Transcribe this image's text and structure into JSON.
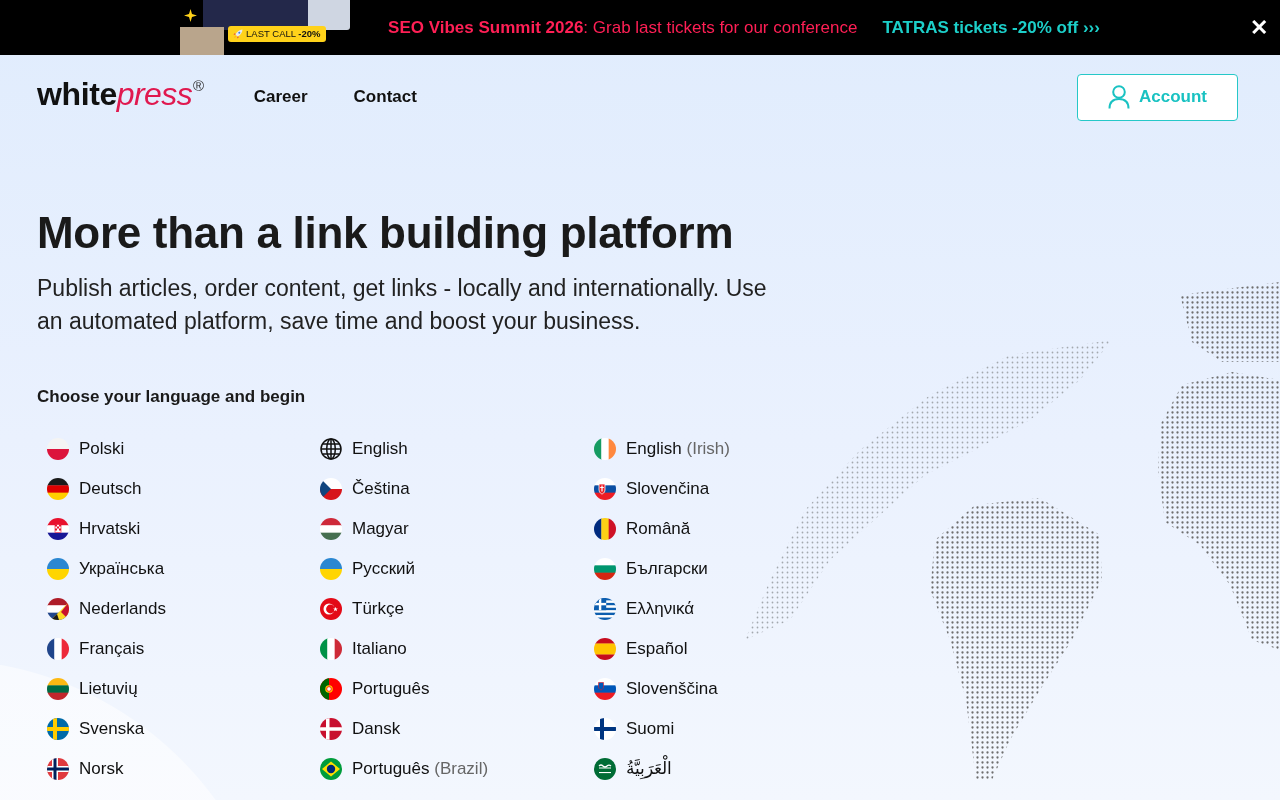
{
  "promo_banner": {
    "badge": "LAST CALL **-20%**",
    "headline": "**SEO Vibes Summit 2026**: Grab last tickets for our conference",
    "link": "TATRAS tickets -20% off ›››",
    "close": "✕"
  },
  "header": {
    "logo": {
      "word": "white",
      "accent": "press",
      "mark": "®"
    },
    "nav": [
      {
        "label": "Career"
      },
      {
        "label": "Contact"
      }
    ],
    "account_button": "Account"
  },
  "hero": {
    "title": "More than a link building platform",
    "subtitle": "Publish articles, order content, get links - locally and internationally. Use an automated platform, save time and boost your business."
  },
  "languages": {
    "heading": "Choose your language and begin",
    "items": [
      {
        "name": "Polski",
        "kind": "poland"
      },
      {
        "name": "English",
        "kind": "globe"
      },
      {
        "name": "English",
        "note": "(Irish)",
        "kind": "ireland"
      },
      {
        "name": "Deutsch",
        "kind": "germany"
      },
      {
        "name": "Čeština",
        "kind": "czechia"
      },
      {
        "name": "Slovenčina",
        "kind": "slovakia"
      },
      {
        "name": "Hrvatski",
        "kind": "croatia"
      },
      {
        "name": "Magyar",
        "kind": "hungary"
      },
      {
        "name": "Română",
        "kind": "romania"
      },
      {
        "name": "Українська",
        "kind": "ukraine"
      },
      {
        "name": "Русский",
        "kind": "ukraine"
      },
      {
        "name": "Български",
        "kind": "bulgaria"
      },
      {
        "name": "Nederlands",
        "kind": "benelux"
      },
      {
        "name": "Türkçe",
        "kind": "turkey"
      },
      {
        "name": "Ελληνικά",
        "kind": "greece"
      },
      {
        "name": "Français",
        "kind": "france"
      },
      {
        "name": "Italiano",
        "kind": "italy"
      },
      {
        "name": "Español",
        "kind": "spain"
      },
      {
        "name": "Lietuvių",
        "kind": "lithuania"
      },
      {
        "name": "Português",
        "kind": "portugal"
      },
      {
        "name": "Slovenščina",
        "kind": "slovenia"
      },
      {
        "name": "Svenska",
        "kind": "sweden"
      },
      {
        "name": "Dansk",
        "kind": "denmark"
      },
      {
        "name": "Suomi",
        "kind": "finland"
      },
      {
        "name": "Norsk",
        "kind": "norway"
      },
      {
        "name": "Português",
        "note": "(Brazil)",
        "kind": "brazil"
      },
      {
        "name": "الْعَرَبِيَّةُ",
        "kind": "saudi"
      }
    ]
  }
}
